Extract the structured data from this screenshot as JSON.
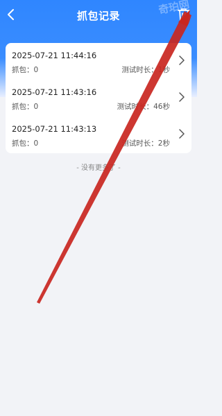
{
  "header": {
    "title": "抓包记录",
    "watermark": "奇珀网",
    "back_icon": "chevron-left-icon",
    "delete_icon": "trash-icon"
  },
  "records": [
    {
      "timestamp": "2025-07-21 11:44:16",
      "packets": "抓包：0",
      "duration": "测试时长：1秒"
    },
    {
      "timestamp": "2025-07-21 11:43:16",
      "packets": "抓包：0",
      "duration": "测试时长：46秒"
    },
    {
      "timestamp": "2025-07-21 11:43:13",
      "packets": "抓包：0",
      "duration": "测试时长：2秒"
    }
  ],
  "footer": {
    "no_more": "- 没有更多了 -"
  },
  "colors": {
    "primary": "#2f86ff",
    "annotation": "#c9261f"
  }
}
